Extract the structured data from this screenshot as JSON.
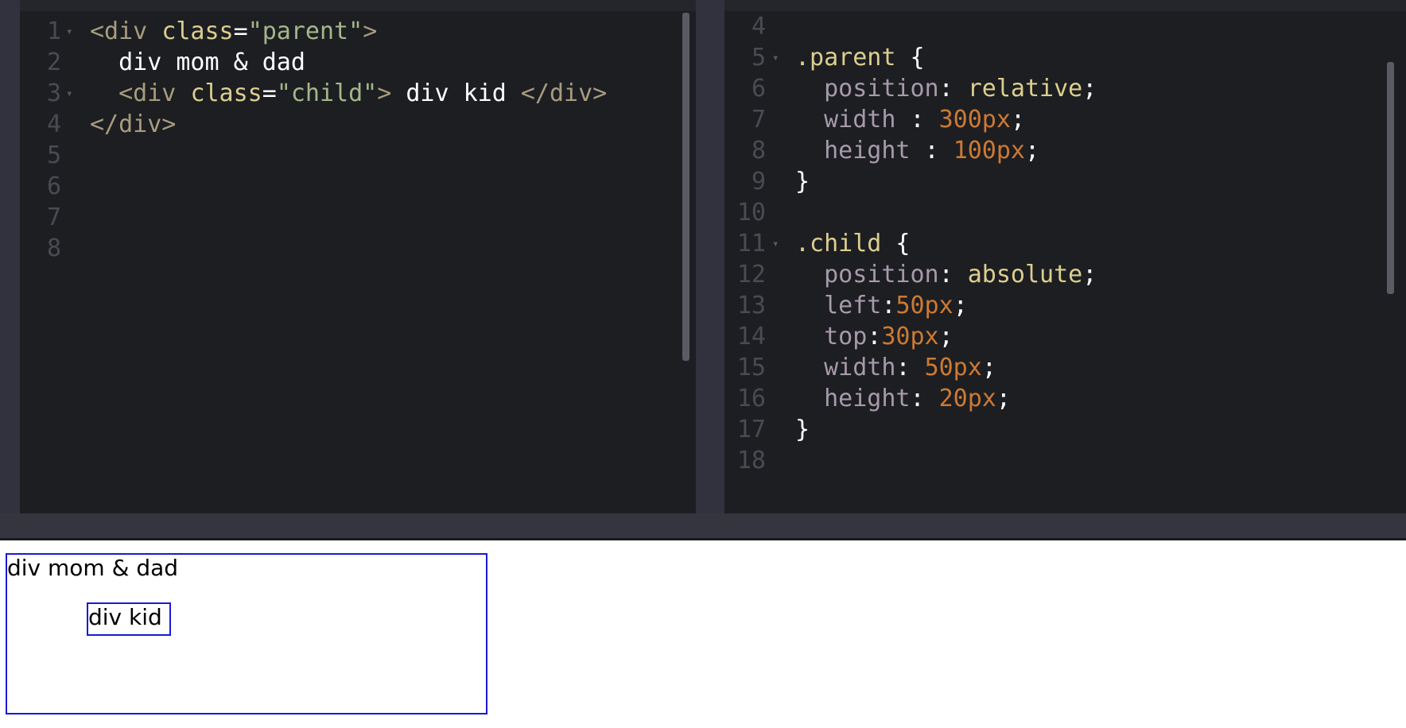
{
  "html_editor": {
    "lines": [
      {
        "n": "1",
        "parts": [
          {
            "t": "<div ",
            "c": "tag"
          },
          {
            "t": "class",
            "c": "attr"
          },
          {
            "t": "=",
            "c": "plain"
          },
          {
            "t": "\"parent\"",
            "c": "str"
          },
          {
            "t": ">",
            "c": "tag"
          }
        ]
      },
      {
        "n": "2",
        "parts": [
          {
            "t": "  div mom & dad",
            "c": "plain"
          }
        ]
      },
      {
        "n": "3",
        "parts": [
          {
            "t": "  <div ",
            "c": "tag"
          },
          {
            "t": "class",
            "c": "attr"
          },
          {
            "t": "=",
            "c": "plain"
          },
          {
            "t": "\"child\"",
            "c": "str"
          },
          {
            "t": ">",
            "c": "tag"
          },
          {
            "t": " div kid ",
            "c": "plain"
          },
          {
            "t": "</div>",
            "c": "tag"
          }
        ]
      },
      {
        "n": "4",
        "parts": [
          {
            "t": "</div>",
            "c": "tag"
          }
        ]
      },
      {
        "n": "5",
        "parts": []
      },
      {
        "n": "6",
        "parts": []
      },
      {
        "n": "7",
        "parts": []
      },
      {
        "n": "8",
        "parts": []
      }
    ]
  },
  "css_editor": {
    "lines": [
      {
        "n": "4",
        "parts": []
      },
      {
        "n": "5",
        "parts": [
          {
            "t": ".parent",
            "c": "sel"
          },
          {
            "t": " {",
            "c": "plain"
          }
        ]
      },
      {
        "n": "6",
        "parts": [
          {
            "t": "  position",
            "c": "prop"
          },
          {
            "t": ": ",
            "c": "plain"
          },
          {
            "t": "relative",
            "c": "kw"
          },
          {
            "t": ";",
            "c": "plain"
          }
        ]
      },
      {
        "n": "7",
        "parts": [
          {
            "t": "  width",
            "c": "prop"
          },
          {
            "t": " : ",
            "c": "plain"
          },
          {
            "t": "300px",
            "c": "num"
          },
          {
            "t": ";",
            "c": "plain"
          }
        ]
      },
      {
        "n": "8",
        "parts": [
          {
            "t": "  height",
            "c": "prop"
          },
          {
            "t": " : ",
            "c": "plain"
          },
          {
            "t": "100px",
            "c": "num"
          },
          {
            "t": ";",
            "c": "plain"
          }
        ]
      },
      {
        "n": "9",
        "parts": [
          {
            "t": "}",
            "c": "plain"
          }
        ]
      },
      {
        "n": "10",
        "parts": []
      },
      {
        "n": "11",
        "parts": [
          {
            "t": ".child",
            "c": "sel"
          },
          {
            "t": " {",
            "c": "plain"
          }
        ]
      },
      {
        "n": "12",
        "parts": [
          {
            "t": "  position",
            "c": "prop"
          },
          {
            "t": ": ",
            "c": "plain"
          },
          {
            "t": "absolute",
            "c": "kw"
          },
          {
            "t": ";",
            "c": "plain"
          }
        ]
      },
      {
        "n": "13",
        "parts": [
          {
            "t": "  left",
            "c": "prop"
          },
          {
            "t": ":",
            "c": "plain"
          },
          {
            "t": "50px",
            "c": "num"
          },
          {
            "t": ";",
            "c": "plain"
          }
        ]
      },
      {
        "n": "14",
        "parts": [
          {
            "t": "  top",
            "c": "prop"
          },
          {
            "t": ":",
            "c": "plain"
          },
          {
            "t": "30px",
            "c": "num"
          },
          {
            "t": ";",
            "c": "plain"
          }
        ]
      },
      {
        "n": "15",
        "parts": [
          {
            "t": "  width",
            "c": "prop"
          },
          {
            "t": ": ",
            "c": "plain"
          },
          {
            "t": "50px",
            "c": "num"
          },
          {
            "t": ";",
            "c": "plain"
          }
        ]
      },
      {
        "n": "16",
        "parts": [
          {
            "t": "  height",
            "c": "prop"
          },
          {
            "t": ": ",
            "c": "plain"
          },
          {
            "t": "20px",
            "c": "num"
          },
          {
            "t": ";",
            "c": "plain"
          }
        ]
      },
      {
        "n": "17",
        "parts": [
          {
            "t": "}",
            "c": "plain"
          }
        ]
      },
      {
        "n": "18",
        "parts": []
      }
    ]
  },
  "preview": {
    "parent_text": "div mom & dad",
    "child_text": "div kid"
  },
  "colors": {
    "tag": "#a89c7f",
    "attribute": "#dccf8f",
    "string": "#a4b78a",
    "property": "#a79aaa",
    "number": "#cc7a33",
    "box_border": "#1a1ad6"
  }
}
